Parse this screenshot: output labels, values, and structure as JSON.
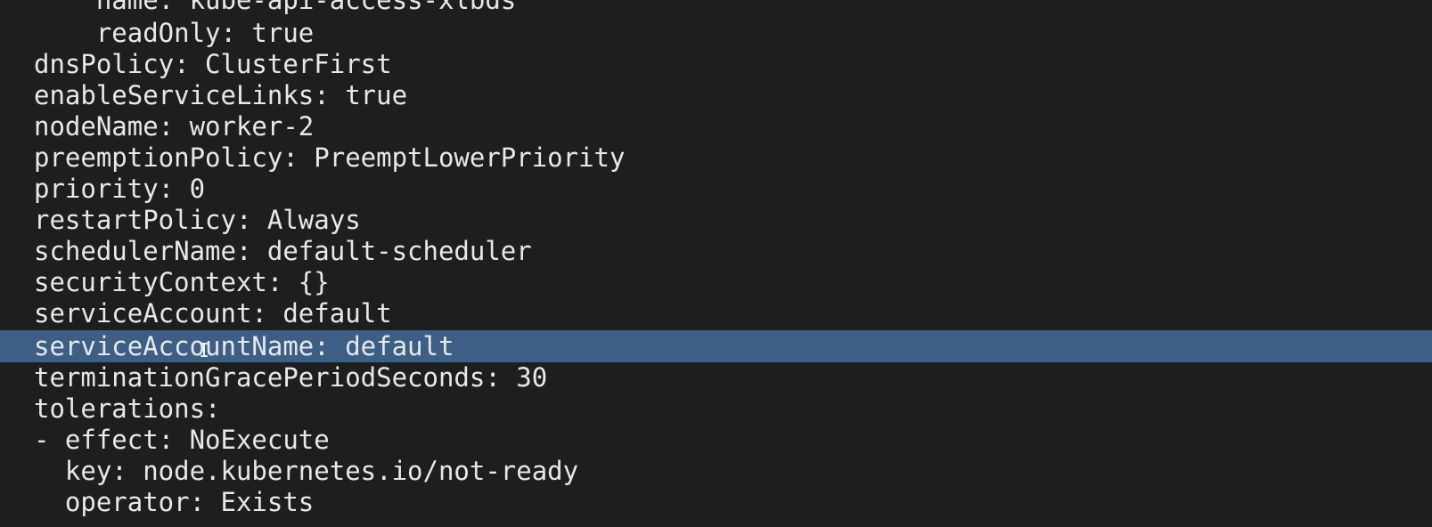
{
  "terminal": {
    "lines": [
      "    name: kube-api-access-xlbds",
      "    readOnly: true",
      "dnsPolicy: ClusterFirst",
      "enableServiceLinks: true",
      "nodeName: worker-2",
      "preemptionPolicy: PreemptLowerPriority",
      "priority: 0",
      "restartPolicy: Always",
      "schedulerName: default-scheduler",
      "securityContext: {}",
      "serviceAccount: default",
      "serviceAccountName: default",
      "terminationGracePeriodSeconds: 30",
      "tolerations:",
      "- effect: NoExecute",
      "  key: node.kubernetes.io/not-ready",
      "  operator: Exists"
    ],
    "selected_line": "serviceAccountName: default",
    "colors": {
      "background": "#1e1e1e",
      "text": "#e8e8e8",
      "selection": "#3d5f86"
    }
  },
  "icons": {
    "mouse_cursor": "text-cursor-icon"
  }
}
